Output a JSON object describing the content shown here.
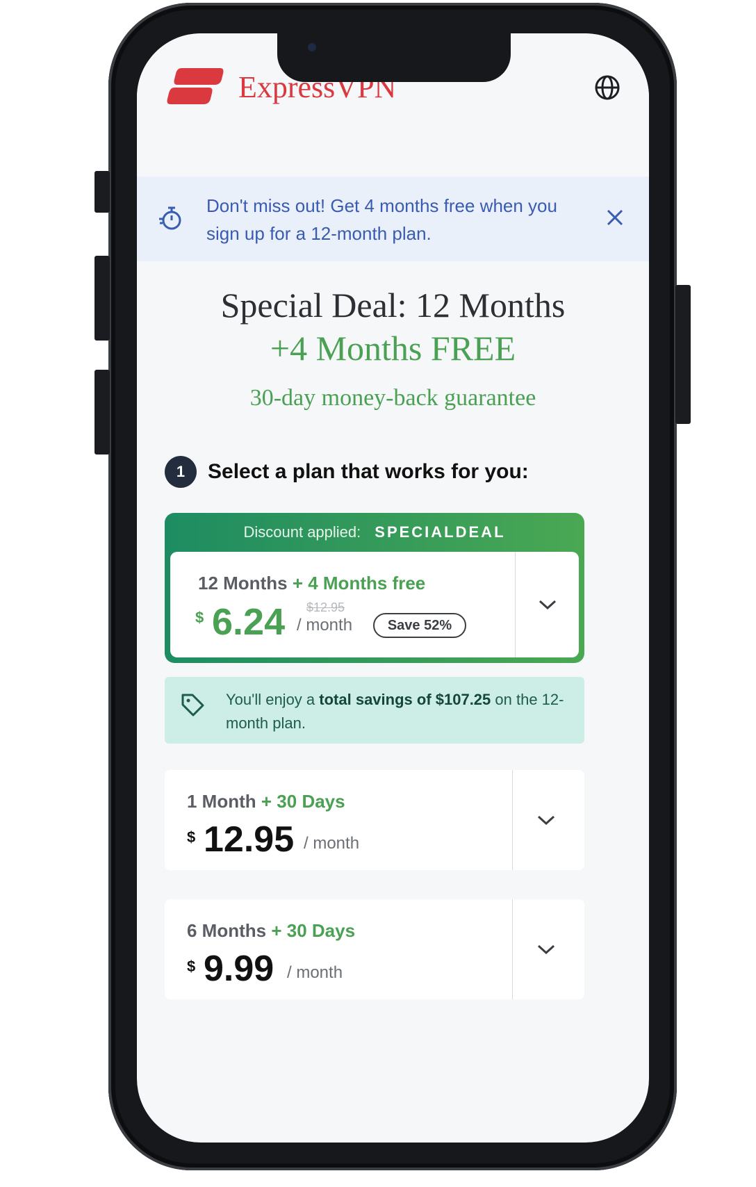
{
  "brand": {
    "name": "ExpressVPN",
    "logo_color": "#da3940"
  },
  "promo": {
    "text": "Don't miss out! Get 4 months free when you sign up for a 12-month plan.",
    "icon": "stopwatch-icon",
    "close_icon": "close-icon"
  },
  "hero": {
    "line1": "Special Deal: 12 Months",
    "line2": "+4 Months FREE",
    "guarantee": "30-day money-back guarantee"
  },
  "step": {
    "number": "1",
    "title": "Select a plan that works for you:"
  },
  "selected_plan": {
    "discount_label": "Discount applied:",
    "discount_code": "SPECIALDEAL",
    "name": "12 Months",
    "bonus": "+ 4 Months free",
    "currency": "$",
    "price": "6.24",
    "original_price": "$12.95",
    "per": "/ month",
    "save_badge": "Save 52%"
  },
  "savings": {
    "prefix": "You'll enjoy a ",
    "highlight": "total savings of $107.25",
    "suffix": " on the 12-month plan."
  },
  "plans": [
    {
      "name": "1 Month",
      "bonus": "+ 30 Days",
      "currency": "$",
      "price": "12.95",
      "per": "/ month"
    },
    {
      "name": "6 Months",
      "bonus": "+ 30 Days",
      "currency": "$",
      "price": "9.99",
      "per": "/ month"
    }
  ],
  "colors": {
    "accent_green": "#4aa053",
    "promo_blue": "#3a5bb2",
    "savings_bg": "#cdeee6"
  }
}
